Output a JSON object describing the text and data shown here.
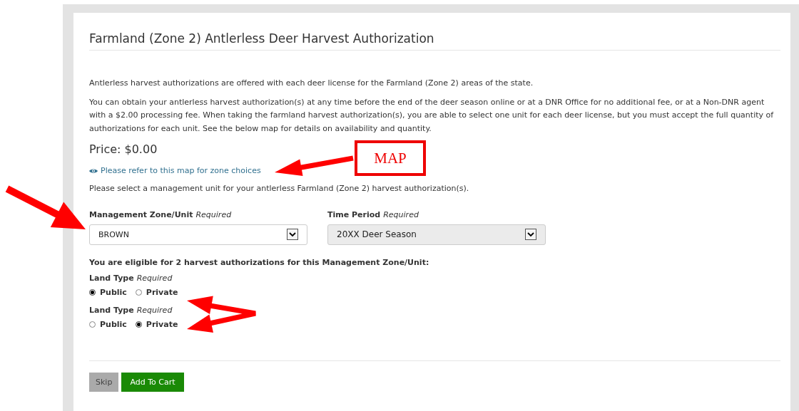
{
  "panel": {
    "title": "Farmland (Zone 2) Antlerless Deer Harvest Authorization",
    "paragraphs": [
      "Antlerless harvest authorizations are offered with each deer license for the Farmland (Zone 2) areas of the state.",
      "You can obtain your antlerless harvest authorization(s) at any time before the end of the deer season online or at a DNR Office for no additional fee, or at a Non-DNR agent with a $2.00 processing fee. When taking the farmland harvest authorization(s), you are able to select one unit for each deer license, but you must accept the full quantity of authorizations for each unit. See the below map for details on availability and quantity."
    ],
    "price": "Price: $0.00",
    "map_link": "Please refer to this map for zone choices",
    "instruction": "Please select a management unit for your antlerless Farmland (Zone 2) harvest authorization(s).",
    "fields": [
      {
        "label": "Management Zone/Unit",
        "hint": "Required",
        "value": "BROWN",
        "disabled": false
      },
      {
        "label": "Time Period",
        "hint": "Required",
        "value": "20XX Deer Season",
        "disabled": true
      }
    ],
    "eligibility": "You are eligible for 2 harvest authorizations for this Management Zone/Unit:",
    "land_types": [
      {
        "label": "Land Type",
        "hint": "Required",
        "options": [
          {
            "label": "Public",
            "selected": true
          },
          {
            "label": "Private",
            "selected": false
          }
        ]
      },
      {
        "label": "Land Type",
        "hint": "Required",
        "options": [
          {
            "label": "Public",
            "selected": false
          },
          {
            "label": "Private",
            "selected": true
          }
        ]
      }
    ],
    "buttons": [
      {
        "label": "Skip",
        "kind": "secondary"
      },
      {
        "label": "Add To Cart",
        "kind": "primary"
      }
    ]
  },
  "annotations": {
    "map_label": "MAP"
  }
}
